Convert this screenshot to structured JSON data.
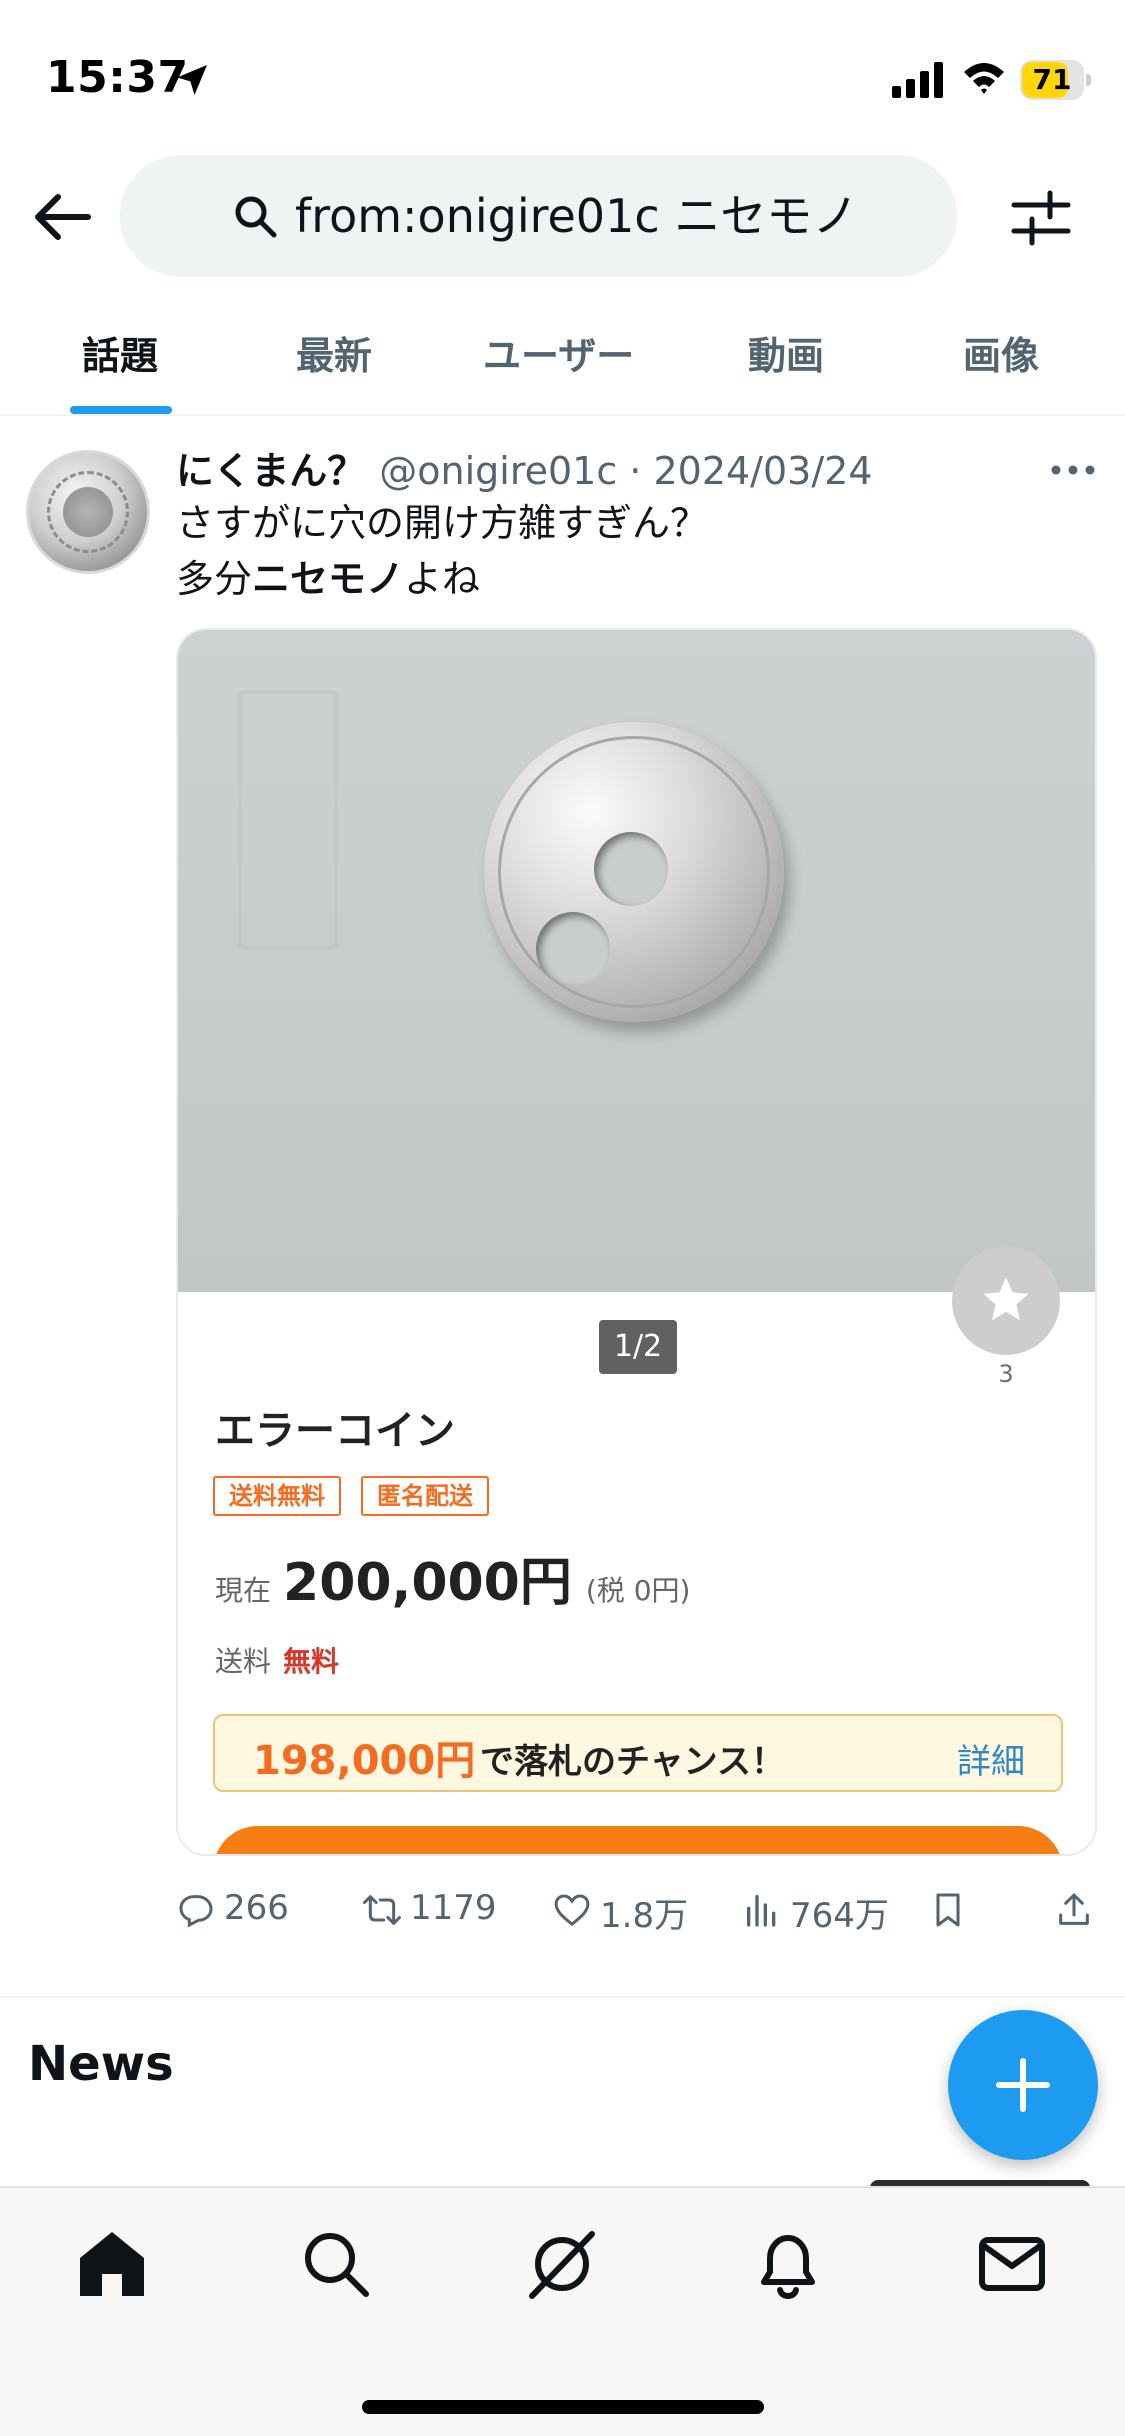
{
  "status_bar": {
    "time": "15:37",
    "battery": "71",
    "icons": [
      "location-arrow-icon",
      "cellular-signal-icon",
      "wifi-icon",
      "battery-icon"
    ],
    "battery_color": "#ffd60a"
  },
  "header": {
    "search_query": "from:onigire01c ニセモノ",
    "icons": [
      "back-arrow-icon",
      "search-icon",
      "filter-icon"
    ]
  },
  "tabs": [
    {
      "label": "話題",
      "active": true
    },
    {
      "label": "最新",
      "active": false
    },
    {
      "label": "ユーザー",
      "active": false
    },
    {
      "label": "動画",
      "active": false
    },
    {
      "label": "画像",
      "active": false
    }
  ],
  "tweet": {
    "display_name": "にくまん？",
    "meta": "@onigire01c · 2024/03/24",
    "text_line1": "さすがに穴の開け方雑すぎん？",
    "text_line2_before": "多分",
    "text_line2_bold": "ニセモノ",
    "text_line2_after": "よね",
    "card": {
      "pager": "1/2",
      "favorite_count": "3",
      "title": "エラーコイン",
      "badges": [
        "送料無料",
        "匿名配送"
      ],
      "price_label": "現在",
      "price": "200,000円",
      "tax": "(税 0円)",
      "shipping_label": "送料",
      "shipping_value": "無料",
      "chance_amount": "198,000円",
      "chance_text": "で落札のチャンス！",
      "chance_link": "詳細",
      "accent_color": "#f77e13"
    },
    "actions": {
      "replies": "266",
      "retweets": "1179",
      "likes": "1.8万",
      "views": "764万"
    }
  },
  "news_heading": "News",
  "bottom_nav": [
    "home-icon",
    "search-icon",
    "grok-icon",
    "notifications-bell-icon",
    "messages-envelope-icon"
  ],
  "accent": "#1d9bf0"
}
